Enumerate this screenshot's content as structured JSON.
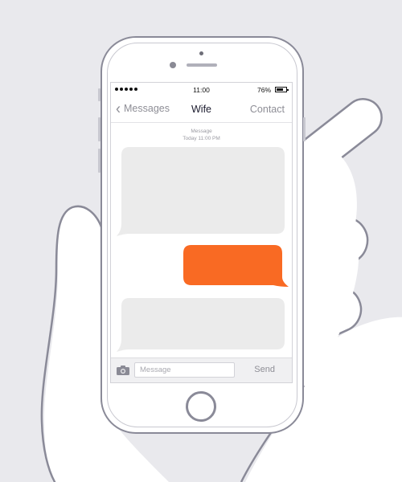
{
  "status_bar": {
    "time": "11:00",
    "battery": "76%",
    "battery_level": 0.76
  },
  "nav": {
    "back_label": "Messages",
    "title": "Wife",
    "contact_label": "Contact"
  },
  "conversation": {
    "header_label": "Message",
    "header_time": "Today 11:00 PM",
    "messages": [
      {
        "direction": "incoming",
        "text": ""
      },
      {
        "direction": "outgoing",
        "text": ""
      },
      {
        "direction": "incoming",
        "text": ""
      }
    ]
  },
  "composer": {
    "placeholder": "Message",
    "send_label": "Send"
  },
  "colors": {
    "background": "#e9e9ed",
    "outline": "#8a8a98",
    "incoming_bubble": "#ebebeb",
    "outgoing_bubble": "#f96a23",
    "muted_text": "#8e8e96"
  },
  "icons": {
    "back": "chevron-left-icon",
    "camera": "camera-icon",
    "battery": "battery-icon",
    "signal": "signal-dots-icon"
  }
}
